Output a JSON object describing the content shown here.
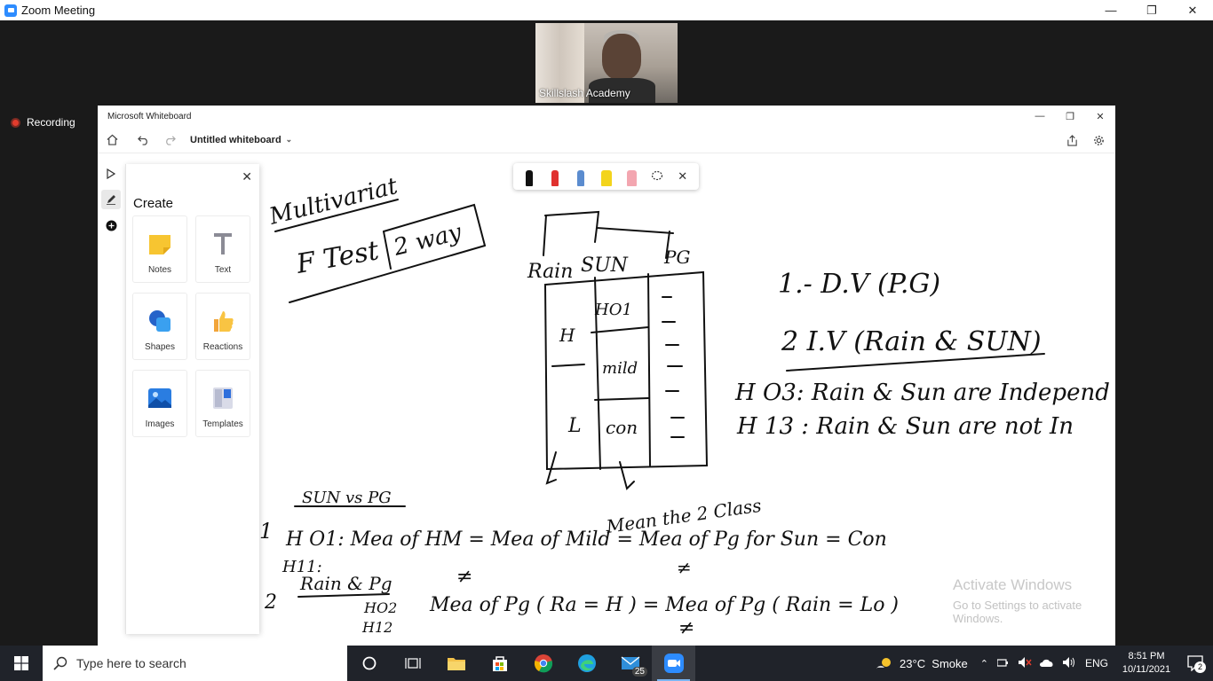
{
  "zoom": {
    "title": "Zoom Meeting",
    "participant_name": "Skillslash Academy",
    "recording_label": "Recording"
  },
  "whiteboard": {
    "app_title": "Microsoft Whiteboard",
    "board_name": "Untitled whiteboard",
    "create_panel": {
      "title": "Create",
      "tiles": [
        "Notes",
        "Text",
        "Shapes",
        "Reactions",
        "Images",
        "Templates"
      ]
    },
    "ink_colors": [
      "#111111",
      "#e0312f",
      "#5b8ccf",
      "#f3d41c",
      "#f3a6b0"
    ],
    "handwriting": {
      "title": "Multivariat",
      "ftest": "F Test",
      "two_way": "2 way",
      "rain": "Rain",
      "sun": "SUN",
      "pg": "PG",
      "ho1": "HO1",
      "hi": "H",
      "mild": "mild",
      "lo": "L",
      "con": "con",
      "dv": "1.- D.V (P.G)",
      "iv": "2 I.V (Rain & SUN)",
      "h03": "H O3: Rain & Sun are Independ",
      "h13": "H 13 : Rain & Sun are not In",
      "sunvspg": "SUN vs PG",
      "mean_the_2_class": "Mean the 2 Class",
      "line1": "H O1: Mea of HM = Mea of Mild = Mea of Pg for Sun = Con",
      "h11": "H11:",
      "rain_pg": "Rain & Pg",
      "line2": "Mea of Pg ( Ra = H ) = Mea of Pg ( Rain = Lo )",
      "ho2": "HO2",
      "h12": "H12",
      "neq": "≠",
      "one": "1",
      "two": "2"
    }
  },
  "system": {
    "activate_title": "Activate Windows",
    "activate_sub": "Go to Settings to activate Windows.",
    "search_placeholder": "Type here to search",
    "weather": "23°C  Smoke",
    "language": "ENG",
    "time": "8:51 PM",
    "date": "10/11/2021",
    "mail_badge": "25",
    "notification_count": "2"
  }
}
